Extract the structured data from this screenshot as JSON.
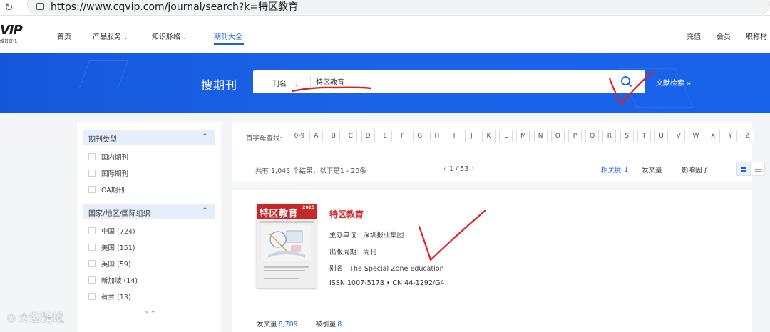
{
  "browser": {
    "url": "https://www.cqvip.com/journal/search?k=特区教育"
  },
  "site": {
    "logo_mark": "VIP",
    "logo_sub": "维普资讯",
    "nav": [
      {
        "label": "首页"
      },
      {
        "label": "产品服务"
      },
      {
        "label": "知识脉络"
      },
      {
        "label": "期刊大全"
      }
    ],
    "nav_right": [
      {
        "label": "充值"
      },
      {
        "label": "会员"
      },
      {
        "label": "职称材"
      }
    ]
  },
  "banner": {
    "title": "搜期刊",
    "search_type": "刊名",
    "search_value": "特区教育",
    "advanced_link": "文献检索 »"
  },
  "sidebar": {
    "facets": [
      {
        "title": "期刊类型",
        "options": [
          {
            "label": "国内期刊"
          },
          {
            "label": "国际期刊"
          },
          {
            "label": "OA期刊"
          }
        ]
      },
      {
        "title": "国家/地区/国际组织",
        "options": [
          {
            "label": "中国 (724)"
          },
          {
            "label": "美国 (151)"
          },
          {
            "label": "英国 (59)"
          },
          {
            "label": "新加坡 (14)"
          },
          {
            "label": "荷兰 (13)"
          }
        ]
      }
    ]
  },
  "filter": {
    "letter_label": "首字母查找:",
    "letters": [
      "0-9",
      "A",
      "B",
      "C",
      "D",
      "E",
      "F",
      "G",
      "H",
      "I",
      "J",
      "K",
      "L",
      "M",
      "N",
      "O",
      "P",
      "Q",
      "R",
      "S",
      "T",
      "U",
      "V",
      "W",
      "X",
      "Y",
      "Z"
    ]
  },
  "results": {
    "summary": "共有 1,043 个结果，以下是1 - 20条",
    "pager": "1 / 53",
    "sort": [
      {
        "label": "相关度 ↓"
      },
      {
        "label": "发文量"
      },
      {
        "label": "影响因子"
      }
    ]
  },
  "journal": {
    "cover_title": "特区教育",
    "cover_year": "2025",
    "title": "特区教育",
    "sponsor_key": "主办单位:",
    "sponsor": "深圳报业集团",
    "period_key": "出版周期:",
    "period": "周刊",
    "alias_key": "别名:",
    "alias": "The Special Zone Education",
    "issn_line": "ISSN 1007-5178  •  CN 44-1292/G4",
    "articles_label": "发文量",
    "articles": "6,709",
    "cited_label": "被引量",
    "cited": "8"
  },
  "watermark": {
    "text": "大数跨境"
  },
  "colors": {
    "brand_blue": "#1761e6",
    "banner_blue": "#1a64ea",
    "journal_title_red": "#d62b2b",
    "annotation_red": "#e02020"
  },
  "icons": {
    "reload": "reload-icon",
    "site_info": "site-info-icon",
    "search": "search-icon",
    "chevron": "chevron-down-icon",
    "collapse": "chevron-up-icon",
    "grid_view": "grid-view-icon",
    "list_view": "list-view-icon"
  }
}
